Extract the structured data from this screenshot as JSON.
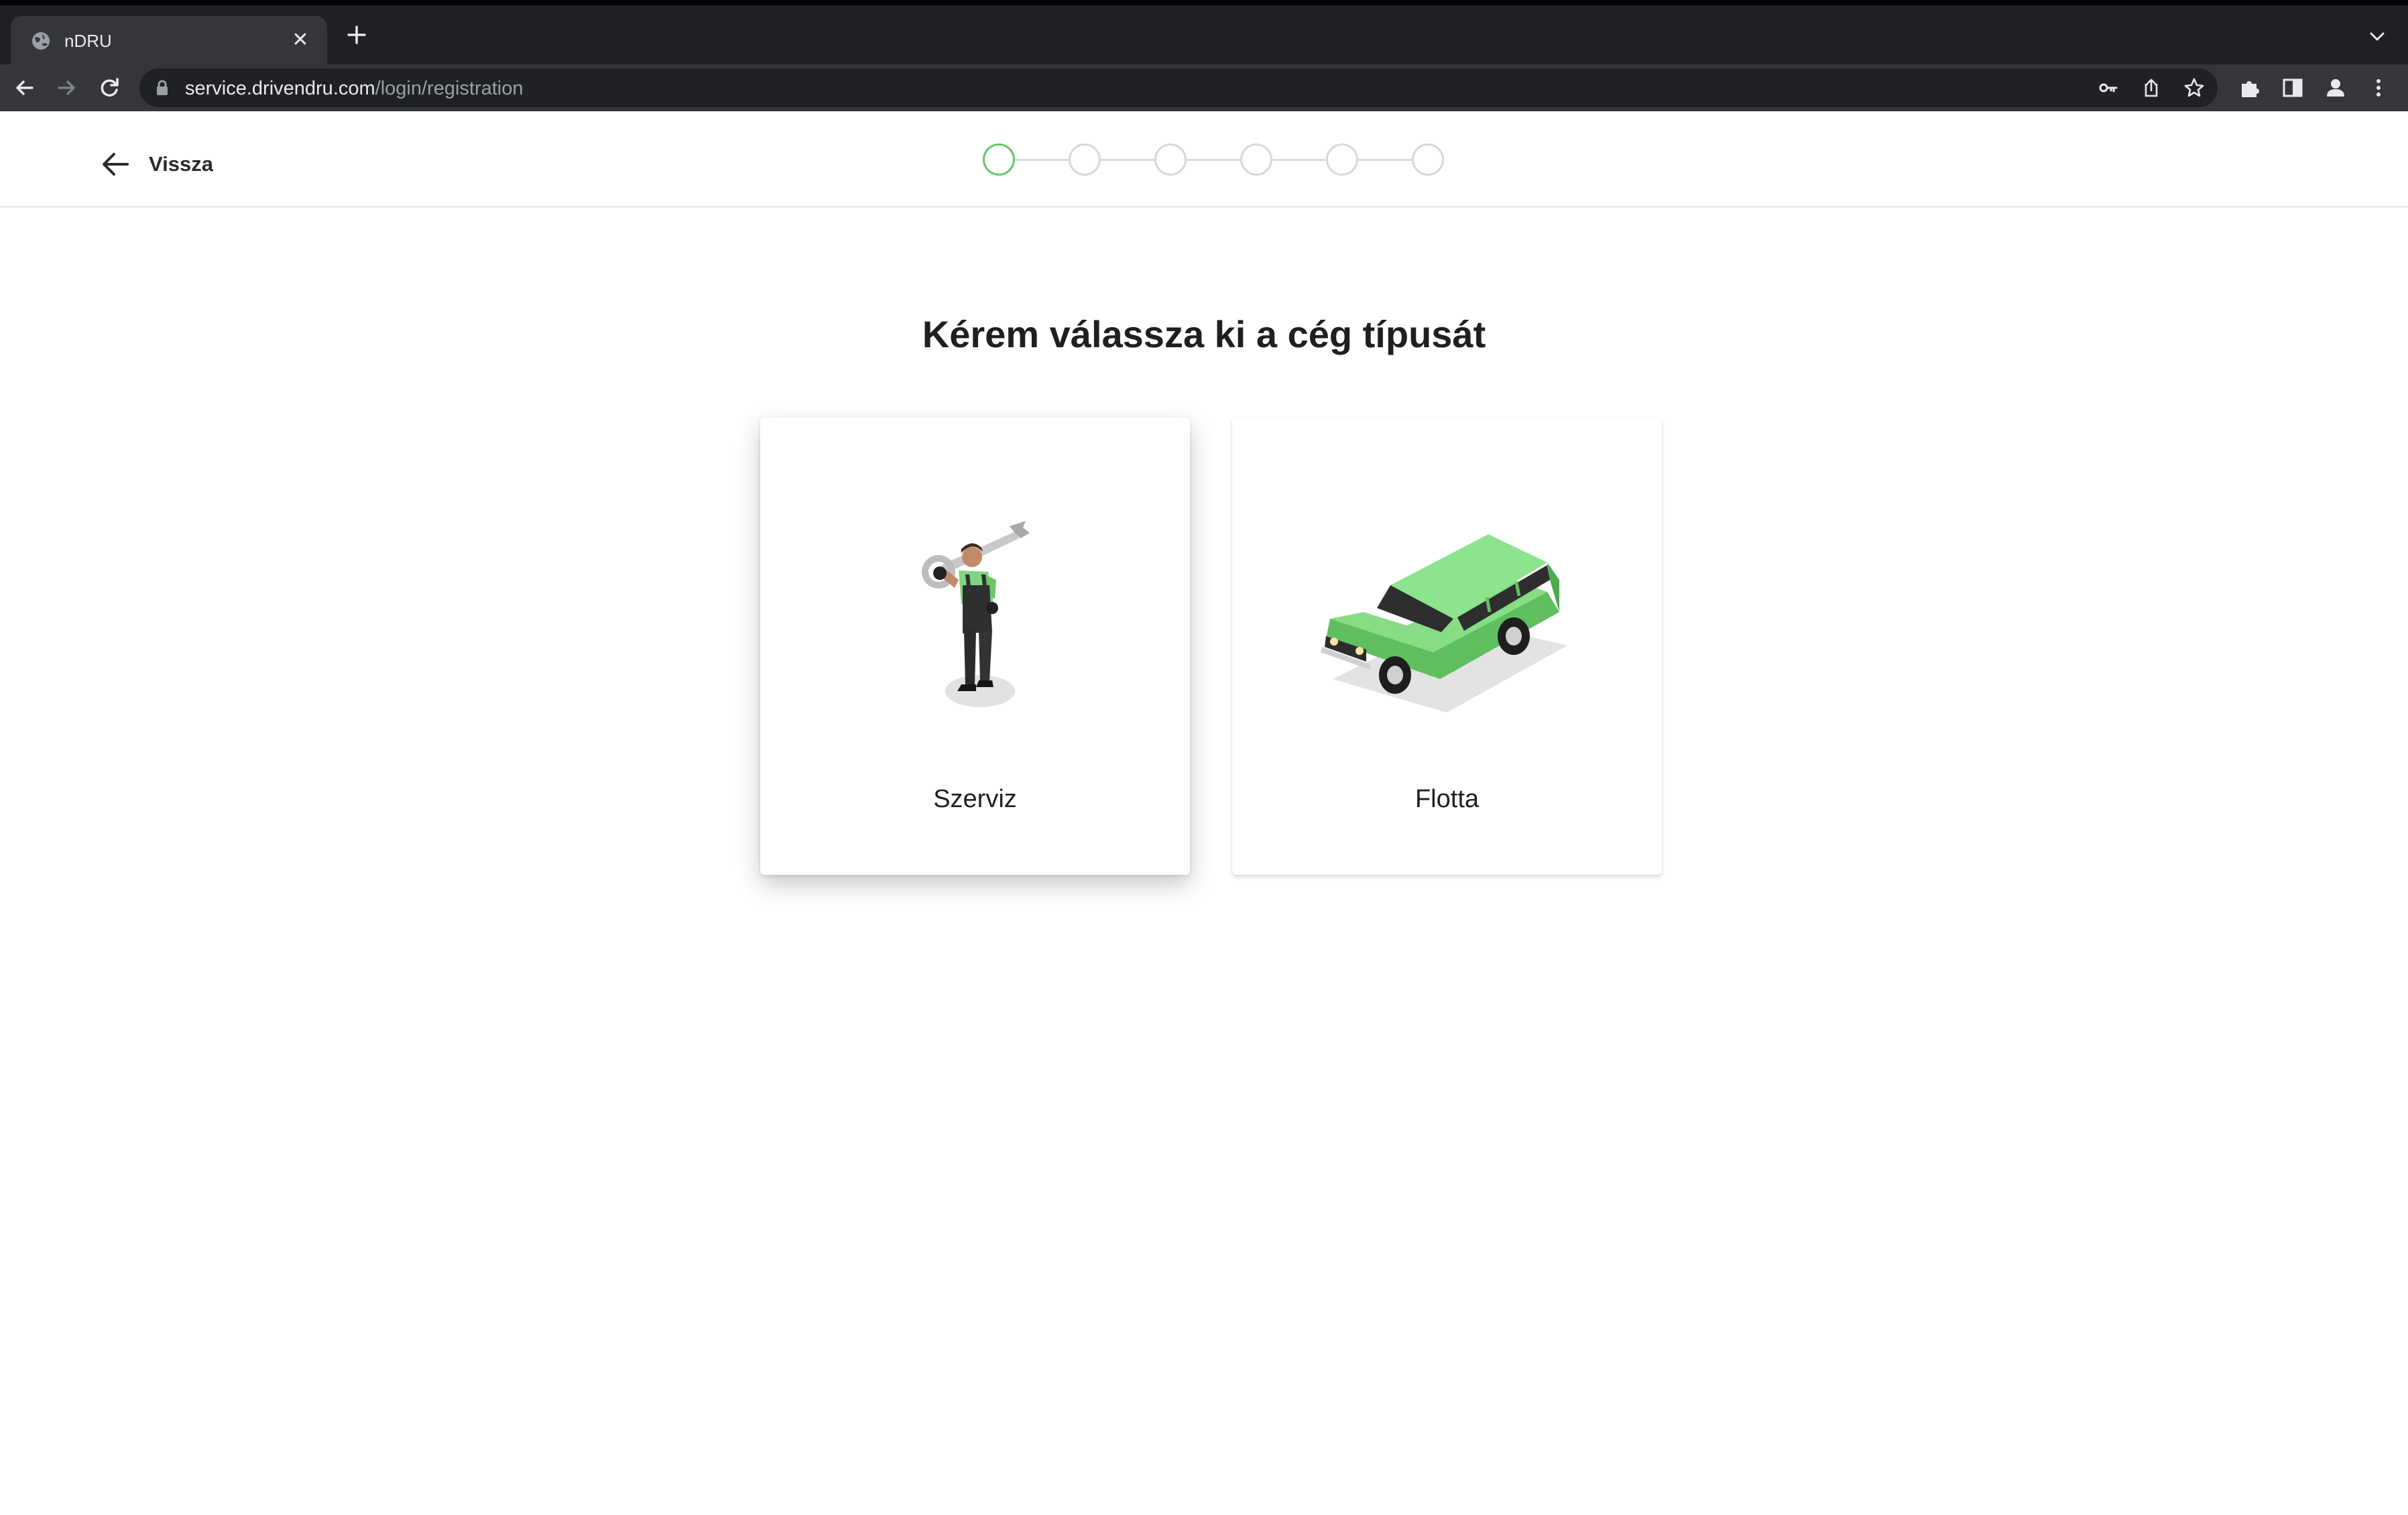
{
  "browser": {
    "tab_title": "nDRU",
    "url_host": "service.drivendru.com",
    "url_path": "/login/registration"
  },
  "header": {
    "back_label": "Vissza",
    "steps_total": 6,
    "active_step": 1,
    "accent_color": "#64c96a"
  },
  "main": {
    "title": "Kérem válassza ki a cég típusát",
    "options": [
      {
        "label": "Szerviz",
        "icon": "mechanic-illustration",
        "selected": true
      },
      {
        "label": "Flotta",
        "icon": "car-illustration",
        "selected": false
      }
    ]
  }
}
